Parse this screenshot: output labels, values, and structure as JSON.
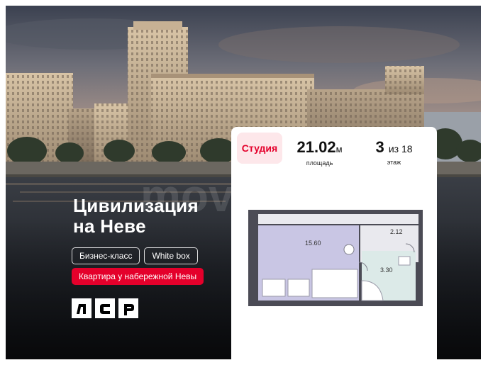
{
  "banner": {
    "title_line1": "Цивилизация",
    "title_line2": "на Неве",
    "tags": [
      "Бизнес-класс",
      "White box"
    ],
    "promo": "Квартира у набережной Невы",
    "logo_letters": [
      "Л",
      "С",
      "Р"
    ],
    "watermark": "movitro.ru",
    "colors": {
      "accent": "#e4002b",
      "card": "#ffffff",
      "badge_bg": "#fde7ea",
      "plan_room": "#c9c6e4"
    }
  },
  "card": {
    "type_badge": "Студия",
    "area_value": "21.02",
    "area_unit": "м",
    "area_caption": "площадь",
    "floor_value": "3",
    "floor_of": "из 18",
    "floor_caption": "этаж",
    "plan": {
      "room_area": "15.60",
      "hall_area": "2.12",
      "bath_area": "3.30"
    }
  }
}
